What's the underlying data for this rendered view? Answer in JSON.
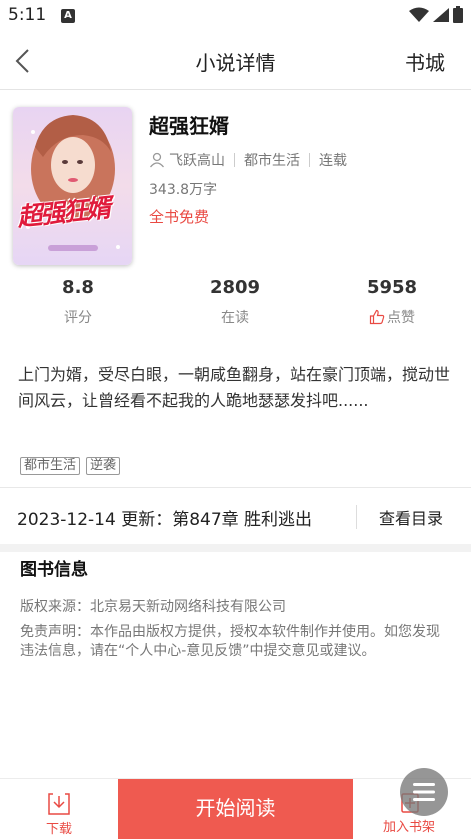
{
  "status_bar": {
    "time": "5:11",
    "a_icon": "A"
  },
  "header": {
    "title": "小说详情",
    "right_link": "书城"
  },
  "book": {
    "title": "超强狂婿",
    "author": "飞跃高山",
    "category": "都市生活",
    "status": "连载",
    "word_count": "343.8万字",
    "free_label": "全书免费",
    "cover_art_text": "超强狂婿"
  },
  "stats": [
    {
      "value": "8.8",
      "label": "评分"
    },
    {
      "value": "2809",
      "label": "在读"
    },
    {
      "value": "5958",
      "label": "点赞"
    }
  ],
  "description": "上门为婿，受尽白眼，一朝咸鱼翻身，站在豪门顶端，搅动世间风云，让曾经看不起我的人跪地瑟瑟发抖吧......",
  "tags": [
    "都市生活",
    "逆袭"
  ],
  "update": {
    "text": "2023-12-14 更新：第847章 胜利逃出",
    "catalog_label": "查看目录"
  },
  "book_info": {
    "section_title": "图书信息",
    "copyright": "版权来源：北京易天新动网络科技有限公司",
    "disclaimer": "免责声明：本作品由版权方提供，授权本软件制作并使用。如您发现违法信息，请在“个人中心-意见反馈”中提交意见或建议。"
  },
  "bottom_bar": {
    "download_label": "下载",
    "read_label": "开始阅读",
    "shelf_label": "加入书架"
  },
  "colors": {
    "accent": "#ef5a50",
    "accent_text": "#e94a43"
  }
}
